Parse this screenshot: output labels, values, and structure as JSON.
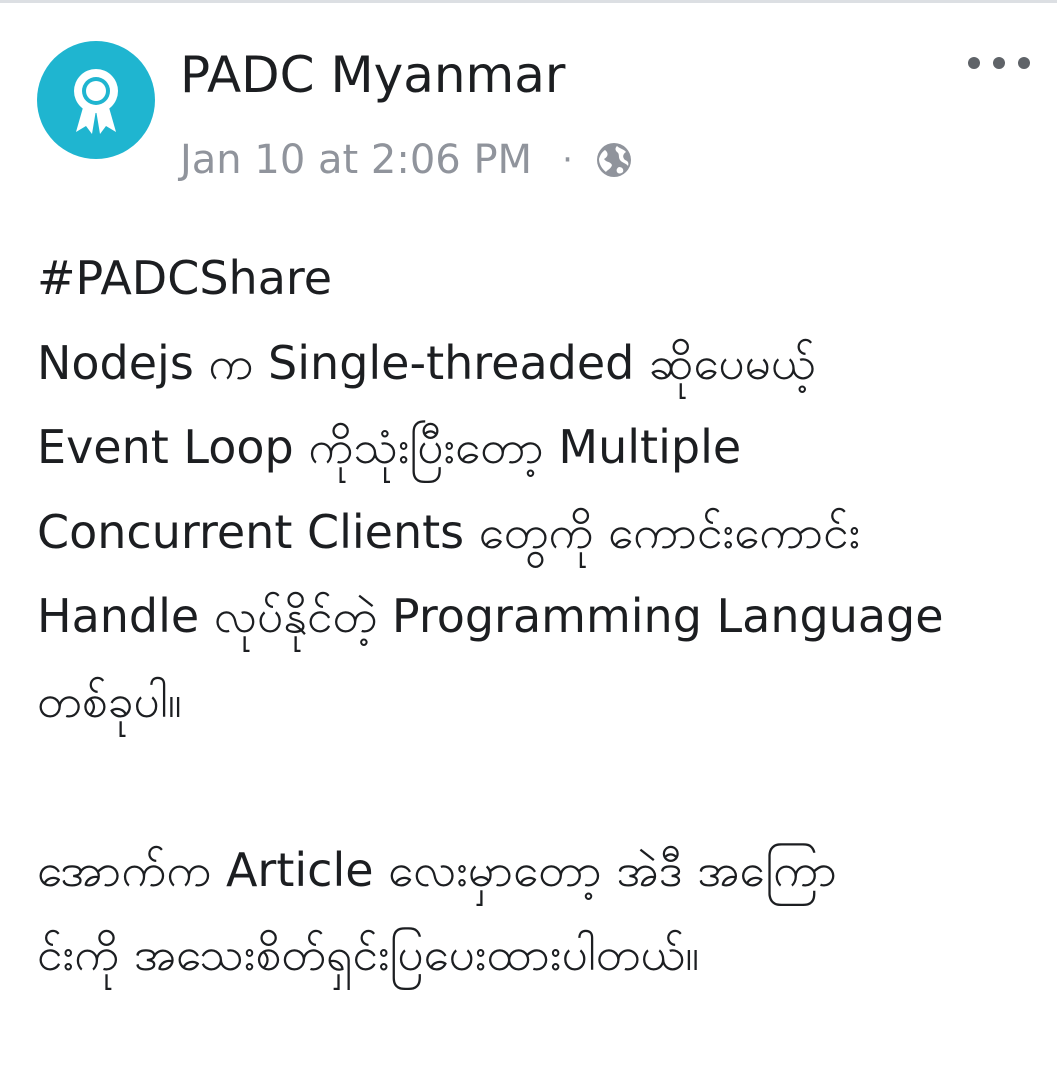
{
  "post": {
    "author": "PADC Myanmar",
    "timestamp": "Jan 10 at 2:06 PM",
    "separator": "·",
    "privacy_icon": "globe-icon",
    "avatar_icon": "award-ribbon-icon",
    "more_icon": "more-options-icon",
    "hashtag": "#PADCShare",
    "body_lines": [
      "Nodejs က Single-threaded ဆိုပေမယ့်",
      "Event Loop ကိုသုံးပြီးတော့ Multiple",
      "Concurrent Clients တွေကို ကောင်းကောင်း",
      "Handle လုပ်နိုင်တဲ့ Programming Language",
      "တစ်ခုပါ။",
      "",
      "အောက်က Article လေးမှာတော့ အဲဒီ အကြော",
      "င်းကို အသေးစိတ်ရှင်းပြပေးထားပါတယ်။"
    ]
  },
  "colors": {
    "avatar_bg": "#1fb5d0",
    "meta_text": "#90949c",
    "body_text": "#1c1e21"
  }
}
